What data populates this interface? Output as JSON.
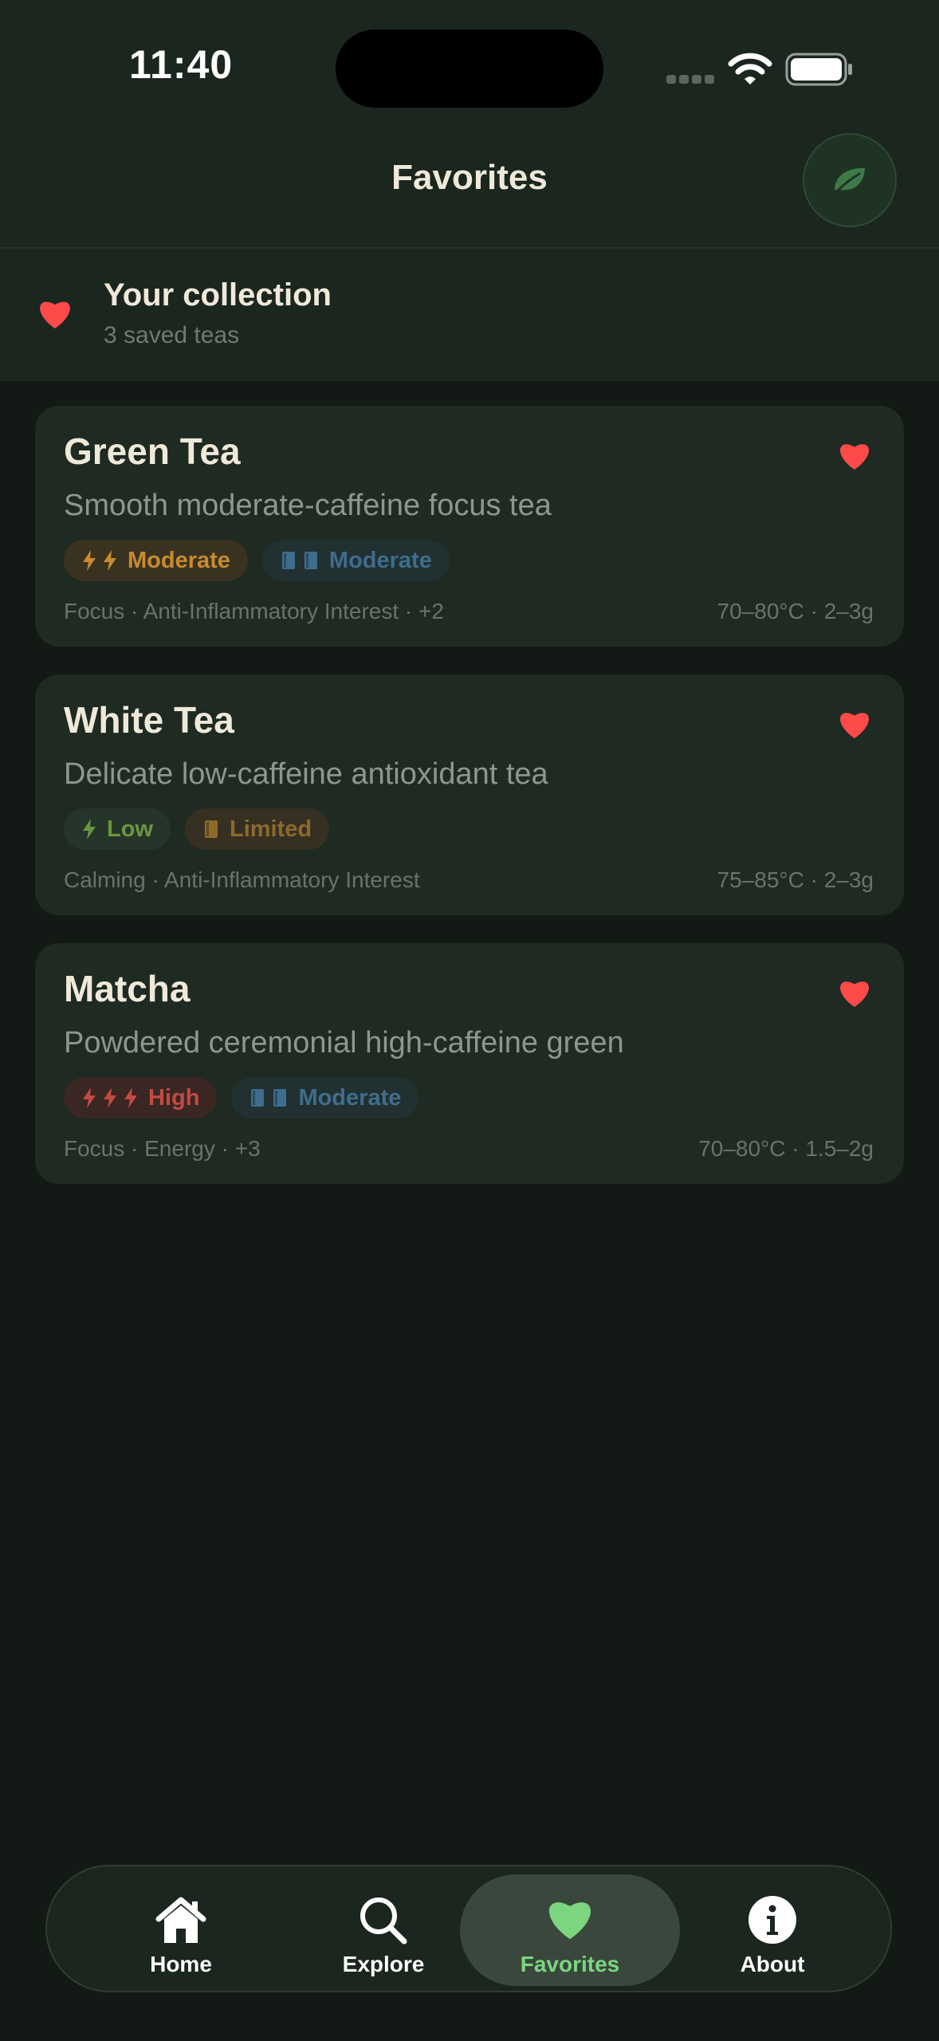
{
  "status_bar": {
    "time": "11:40"
  },
  "header": {
    "title": "Favorites",
    "action_icon": "leaf-icon"
  },
  "collection": {
    "title": "Your collection",
    "subtitle": "3 saved teas"
  },
  "teas": [
    {
      "name": "Green Tea",
      "description": "Smooth moderate-caffeine focus tea",
      "caffeine": {
        "label": "Moderate",
        "bolts": 2,
        "color": "#c88a30"
      },
      "evidence": {
        "label": "Moderate",
        "books": 2,
        "color": "#3f6d8d"
      },
      "tags": "Focus · Anti-Inflammatory Interest · +2",
      "brew": "70–80°C · 2–3g",
      "favorite": true
    },
    {
      "name": "White Tea",
      "description": "Delicate low-caffeine antioxidant tea",
      "caffeine": {
        "label": "Low",
        "bolts": 1,
        "color": "#6a9640"
      },
      "evidence": {
        "label": "Limited",
        "books": 1,
        "color": "#8d6a2c"
      },
      "tags": "Calming · Anti-Inflammatory Interest",
      "brew": "75–85°C · 2–3g",
      "favorite": true
    },
    {
      "name": "Matcha",
      "description": "Powdered ceremonial high-caffeine green",
      "caffeine": {
        "label": "High",
        "bolts": 3,
        "color": "#c24a43"
      },
      "evidence": {
        "label": "Moderate",
        "books": 2,
        "color": "#3f6d8d"
      },
      "tags": "Focus · Energy · +3",
      "brew": "70–80°C · 1.5–2g",
      "favorite": true
    }
  ],
  "tab_bar": {
    "home": "Home",
    "explore": "Explore",
    "favorites": "Favorites",
    "about": "About",
    "active": "favorites"
  },
  "colors": {
    "heart": "#ff4a4a",
    "accent_green": "#7bd67f",
    "background": "#131a16",
    "card": "#1e2a22"
  }
}
